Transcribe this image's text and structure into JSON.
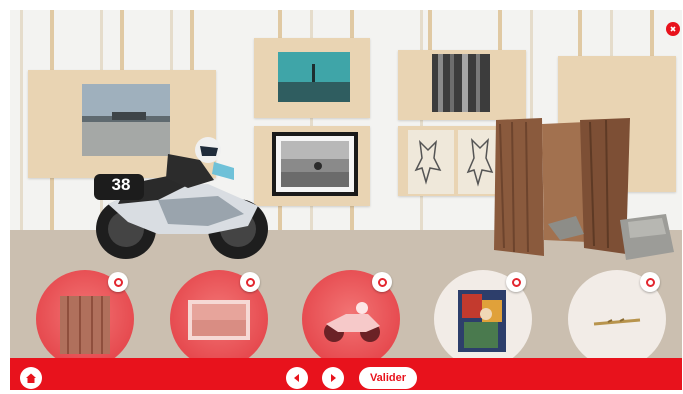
{
  "toolbar": {
    "validate_label": "Valider"
  },
  "icons": {
    "home": "home-icon",
    "previous": "arrow-left-icon",
    "next": "arrow-right-icon",
    "zoom": "zoom-icon",
    "close": "close-icon"
  },
  "colors": {
    "accent": "#e8121c",
    "slot_filled": "#e64a4f",
    "slot_empty": "#f2ece7",
    "panel": "#e9d4b3",
    "floor": "#cbbfb0"
  },
  "gallery": {
    "motorcycle_number": "38"
  },
  "answer_slots": [
    {
      "name": "wooden-boards",
      "state": "filled"
    },
    {
      "name": "framed-photo",
      "state": "filled"
    },
    {
      "name": "motorcycle",
      "state": "filled"
    },
    {
      "name": "painting",
      "state": "empty"
    },
    {
      "name": "stick",
      "state": "empty"
    }
  ]
}
